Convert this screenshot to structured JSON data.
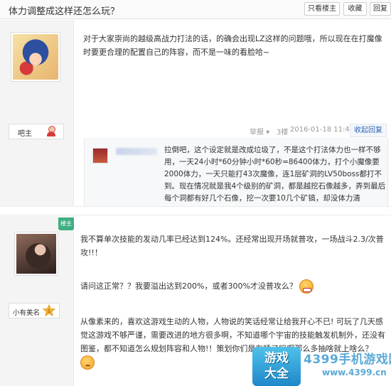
{
  "thread": {
    "title": "体力调整成这样还怎么玩？",
    "buttons": {
      "only_author": "只看楼主",
      "favorite": "收藏",
      "reply": "回复"
    }
  },
  "post1": {
    "role_label": "吧主",
    "text": "对于大家崇尚的越级高战力打法的话，的确会出现LZ这样的问题哦，所以现在在打魔像时要更合理的配置自己的阵容，而不是一味的看脸哈~",
    "meta": {
      "report": "举报 ▾",
      "floor": "3楼",
      "date": "2016-01-18 11:49"
    },
    "reply_button": "收起回复",
    "sub_reply": {
      "text": "拉倒吧，这个设定就是改成垃圾了，不是这个打法体力也一样不够用，一天24小时*60分钟小时*60秒=86400体力，打个小魔像要2000体力，一天只能打43次魔像，连1层矿洞的LV50boss都打不到。现在情况就是我4个级别的矿洞，都是越挖石像越多，弄到最后每个洞都有好几个石像，挖一次要10几个矿镐，却没体力清"
    }
  },
  "post2": {
    "ribbon": "楼主",
    "username": "小有美名",
    "level": "5",
    "para1": "我不算单次技能的发动几率已经达到124%。还经常出现开场就普攻，一场战斗2.3/次普攻!!！",
    "para2": "请问这正常？？我要溢出达到200%，或者300%才没普攻么？",
    "para3": "从像素来的，喜欢这游戏生动的人物，人物说的笑话经常让给我开心不已! 可玩了几天感觉这游戏不够严谨，需要改进的地方很多啊，不知道哪个宇宙的技能触发机制外，还没有图鉴，都不知道怎么规划阵容和人物!！策划你们是在睡了吗啊那么多抽啥就上啥么？"
  },
  "watermark": {
    "badge": "游戏\n大全",
    "name": "4399手机游戏网",
    "url": "www.4399.cn"
  }
}
